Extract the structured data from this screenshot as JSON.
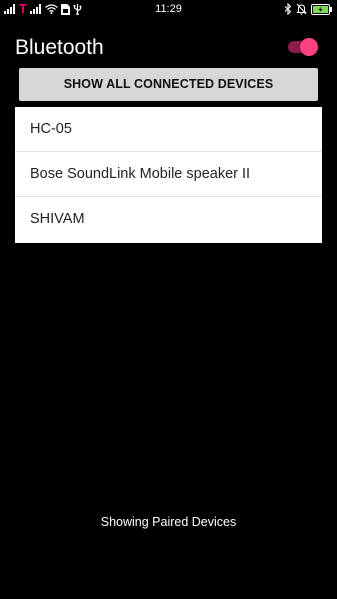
{
  "status_bar": {
    "carrier": "T",
    "time": "11:29"
  },
  "header": {
    "title": "Bluetooth",
    "toggle_on": true
  },
  "actions": {
    "show_connected_label": "SHOW ALL CONNECTED DEVICES"
  },
  "devices": [
    {
      "name": "HC-05"
    },
    {
      "name": "Bose SoundLink Mobile speaker II"
    },
    {
      "name": "SHIVAM"
    }
  ],
  "footer": {
    "status_text": "Showing Paired Devices"
  },
  "colors": {
    "background": "#000000",
    "accent": "#ff4081",
    "toggle_track": "#8a1d4b",
    "button_bg": "#d6d7d7",
    "list_bg": "#ffffff",
    "carrier": "#e20074",
    "battery": "#7ed957"
  },
  "icons": {
    "status_left": [
      "signal-bars-icon",
      "wifi-icon",
      "sim-card-icon",
      "usb-icon"
    ],
    "status_right": [
      "bluetooth-icon",
      "alarm-off-icon",
      "battery-charging-icon"
    ]
  }
}
